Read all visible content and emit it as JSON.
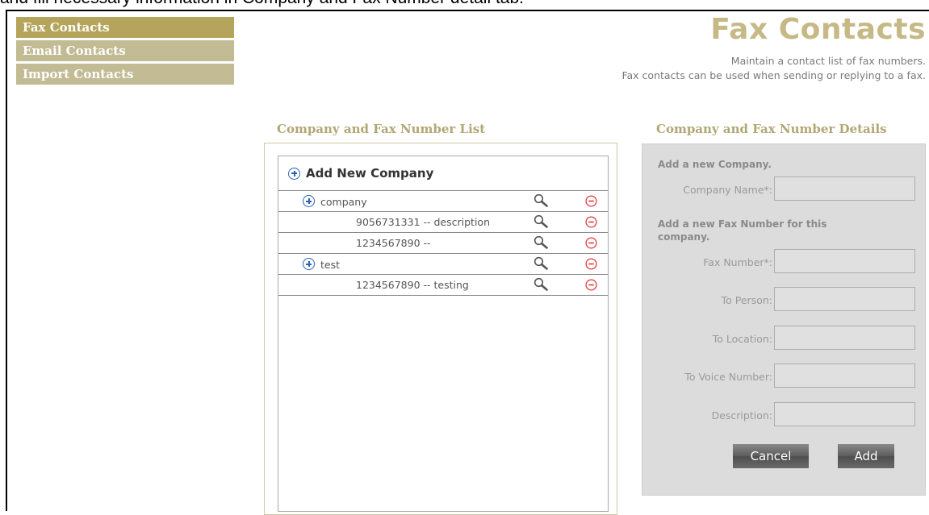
{
  "caption": "and fill necessary information in Company and Fax Number detail tab.",
  "nav": {
    "items": [
      {
        "label": "Fax Contacts"
      },
      {
        "label": "Email Contacts"
      },
      {
        "label": "Import Contacts"
      }
    ],
    "active": "Fax Contacts"
  },
  "header": {
    "title": "Fax Contacts",
    "subtitle_line1": "Maintain a contact list of fax numbers.",
    "subtitle_line2": "Fax contacts can be used when sending or replying to a fax."
  },
  "list": {
    "title": "Company and Fax Number List",
    "add_new_label": "Add New Company",
    "rows": [
      {
        "type": "company",
        "label": "company"
      },
      {
        "type": "fax",
        "label": "9056731331 -- description"
      },
      {
        "type": "fax",
        "label": "1234567890 --"
      },
      {
        "type": "company",
        "label": "test"
      },
      {
        "type": "fax",
        "label": "1234567890 -- testing"
      }
    ]
  },
  "details": {
    "title": "Company and Fax Number Details",
    "company_heading": "Add a new Company.",
    "company_name_label": "Company Name*:",
    "company_name_value": "",
    "fax_heading_line1": "Add a new Fax Number for this",
    "fax_heading_line2": "company.",
    "fields": [
      {
        "label": "Fax Number*:",
        "value": ""
      },
      {
        "label": "To Person:",
        "value": ""
      },
      {
        "label": "To Location:",
        "value": ""
      },
      {
        "label": "To Voice Number:",
        "value": ""
      },
      {
        "label": "Description:",
        "value": ""
      }
    ],
    "cancel_label": "Cancel",
    "add_label": "Add"
  },
  "colors": {
    "nav_active": "#b5a55c",
    "nav_inactive": "#c2bb94",
    "title": "#c6b986",
    "section_title": "#b1a774",
    "plus_icon": "#2a63b4",
    "delete_icon": "#e03a3a"
  }
}
